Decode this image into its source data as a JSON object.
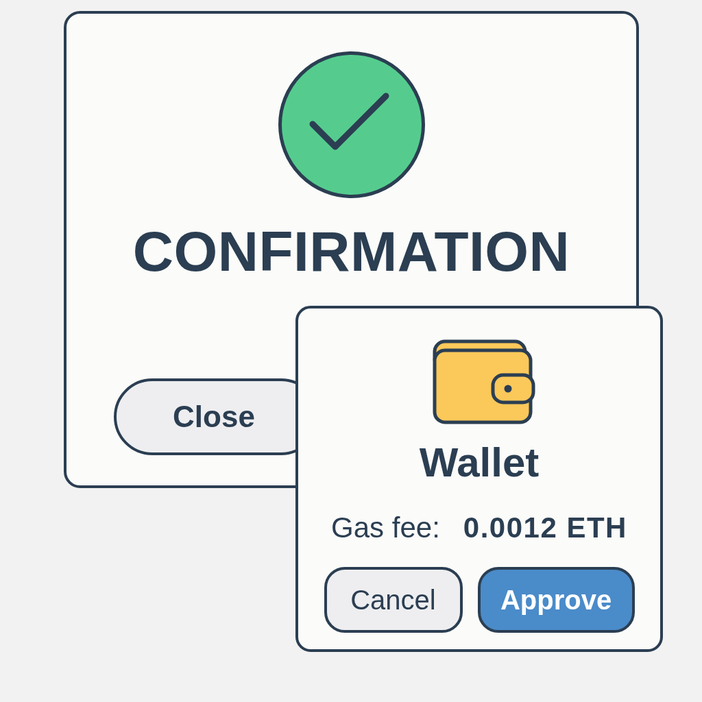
{
  "confirmation_dialog": {
    "title": "CONFIRMATION",
    "buttons": [
      {
        "label": "Close",
        "kind": "secondary"
      }
    ]
  },
  "wallet_dialog": {
    "title": "Wallet",
    "fee_label": "Gas fee:",
    "fee_value": "0.0012 ETH",
    "buttons": [
      {
        "label": "Cancel",
        "kind": "secondary"
      },
      {
        "label": "Approve",
        "kind": "primary"
      }
    ]
  }
}
